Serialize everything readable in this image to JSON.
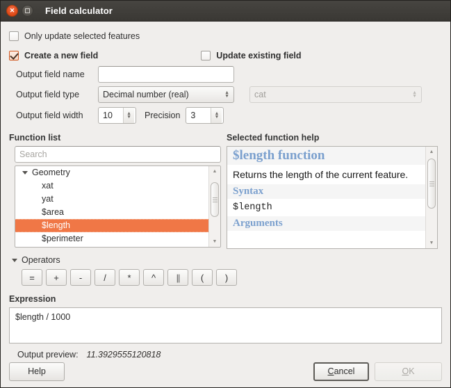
{
  "window": {
    "title": "Field calculator",
    "close_icon": "close-icon",
    "maximize_icon": "maximize-icon"
  },
  "options": {
    "only_update_selected": {
      "label": "Only update selected features",
      "checked": false
    },
    "create_new_field": {
      "label": "Create a new field",
      "checked": true
    },
    "update_existing_field": {
      "label": "Update existing field",
      "checked": false
    }
  },
  "new_field": {
    "name_label": "Output field name",
    "name_value": "",
    "type_label": "Output field type",
    "type_value": "Decimal number (real)",
    "width_label": "Output field width",
    "width_value": "10",
    "precision_label": "Precision",
    "precision_value": "3"
  },
  "existing_field": {
    "value": "cat"
  },
  "function_list": {
    "caption": "Function list",
    "search_placeholder": "Search",
    "search_value": "",
    "items": [
      {
        "label": "Geometry",
        "type": "group",
        "expanded": true
      },
      {
        "label": "xat",
        "type": "child"
      },
      {
        "label": "yat",
        "type": "child"
      },
      {
        "label": "$area",
        "type": "child"
      },
      {
        "label": "$length",
        "type": "child",
        "selected": true
      },
      {
        "label": "$perimeter",
        "type": "child"
      }
    ]
  },
  "help": {
    "caption": "Selected function help",
    "title": "$length function",
    "description": "Returns the length of the current feature.",
    "syntax_heading": "Syntax",
    "syntax_code": "$length",
    "arguments_heading": "Arguments"
  },
  "operators": {
    "caption": "Operators",
    "buttons": [
      "=",
      "+",
      "-",
      "/",
      "*",
      "^",
      "||",
      "(",
      ")"
    ]
  },
  "expression": {
    "caption": "Expression",
    "value": "$length / 1000",
    "preview_label": "Output preview:",
    "preview_value": "11.3929555120818"
  },
  "footer": {
    "help": "Help",
    "cancel": "Cancel",
    "cancel_prefix": "C",
    "cancel_rest": "ancel",
    "ok": "OK",
    "ok_prefix": "O",
    "ok_rest": "K"
  },
  "colors": {
    "titlebar": "#3c3a36",
    "accent": "#f07746",
    "close_button": "#dd4814",
    "window_bg": "#f0eeec",
    "help_heading": "#7ba0ce"
  }
}
